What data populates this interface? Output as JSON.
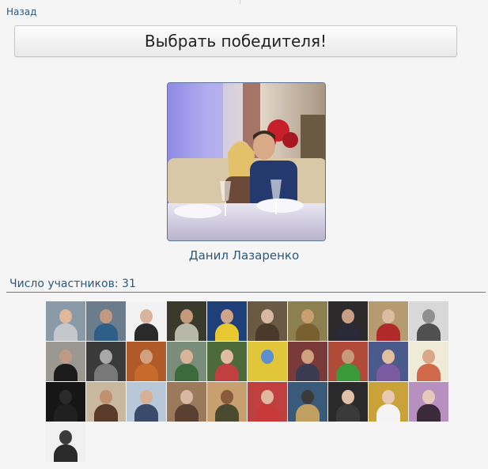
{
  "nav": {
    "back_label": "Назад"
  },
  "action": {
    "pick_winner_label": "Выбрать победителя!"
  },
  "winner": {
    "name": "Данил Лазаренко"
  },
  "participants": {
    "count_label": "Число участников: 31",
    "avatars": [
      {
        "bg": "#8a9aa8",
        "head": "#e0b89a",
        "torso": "#c4c8cc"
      },
      {
        "bg": "#6b7d8c",
        "head": "#c29a82",
        "torso": "#2f5e88"
      },
      {
        "bg": "#f2f2f2",
        "head": "#d8b49c",
        "torso": "#2a2a2a"
      },
      {
        "bg": "#3a3a2c",
        "head": "#c49a7c",
        "torso": "#b8b8a8"
      },
      {
        "bg": "#1f3f79",
        "head": "#d0a488",
        "torso": "#e8c830"
      },
      {
        "bg": "#6a5a44",
        "head": "#d8b8a0",
        "torso": "#4a3a2c"
      },
      {
        "bg": "#8c8050",
        "head": "#c8a070",
        "torso": "#7a6030"
      },
      {
        "bg": "#2c2a2a",
        "head": "#c8a088",
        "torso": "#2a2a38"
      },
      {
        "bg": "#b69a70",
        "head": "#dcbca0",
        "torso": "#b02a2a"
      },
      {
        "bg": "#d8d8d8",
        "head": "#909090",
        "torso": "#505050"
      },
      {
        "bg": "#9a9890",
        "head": "#c09a84",
        "torso": "#1c1c1c"
      },
      {
        "bg": "#3a3a3a",
        "head": "#a8a8a8",
        "torso": "#787878"
      },
      {
        "bg": "#b05a2a",
        "head": "#d0a080",
        "torso": "#c86a2c"
      },
      {
        "bg": "#7a8c7a",
        "head": "#d8b49a",
        "torso": "#3c6a3c"
      },
      {
        "bg": "#4c6a3a",
        "head": "#e0bca0",
        "torso": "#c04040"
      },
      {
        "bg": "#e2c63a",
        "head": "#5c8ed0",
        "torso": "#e2c63a"
      },
      {
        "bg": "#7a3a3a",
        "head": "#d0a080",
        "torso": "#3a3a52"
      },
      {
        "bg": "#b24a3a",
        "head": "#c89a7a",
        "torso": "#3a9a3a"
      },
      {
        "bg": "#4a5a8a",
        "head": "#e0c0a0",
        "torso": "#7a5aa0"
      },
      {
        "bg": "#f0ead8",
        "head": "#d8a888",
        "torso": "#d06a4a"
      },
      {
        "bg": "#161616",
        "head": "#2a2a2a",
        "torso": "#202020"
      },
      {
        "bg": "#c8b8a0",
        "head": "#c09070",
        "torso": "#5a3a2a"
      },
      {
        "bg": "#b8c8d8",
        "head": "#d8b098",
        "torso": "#3a4a6a"
      },
      {
        "bg": "#9a7a5a",
        "head": "#d8b8a0",
        "torso": "#5a4030"
      },
      {
        "bg": "#c8a070",
        "head": "#8a5a3a",
        "torso": "#4a4a30"
      },
      {
        "bg": "#c04040",
        "head": "#e0b8a0",
        "torso": "#c83a3a"
      },
      {
        "bg": "#3a5a7a",
        "head": "#3a3a3a",
        "torso": "#c0a060"
      },
      {
        "bg": "#2a2a2a",
        "head": "#e0c0a8",
        "torso": "#3a3a3a"
      },
      {
        "bg": "#caa23a",
        "head": "#e8c8b0",
        "torso": "#f4f4f4"
      },
      {
        "bg": "#b890c0",
        "head": "#e8c8b8",
        "torso": "#3a2a3a"
      },
      {
        "bg": "#f0f0f0",
        "head": "#3a3a3a",
        "torso": "#2a2a2a"
      }
    ]
  }
}
